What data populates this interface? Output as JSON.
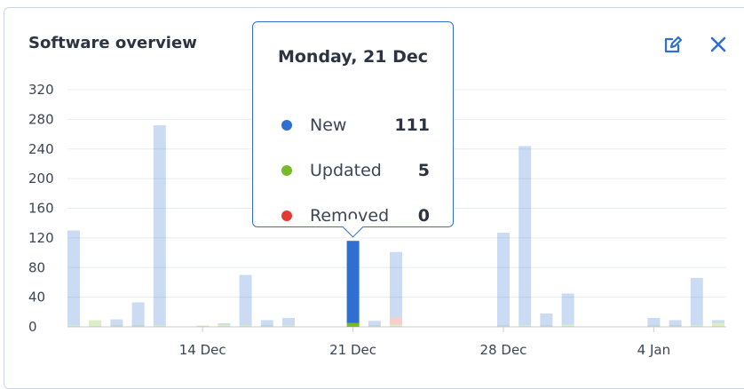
{
  "widget": {
    "title": "Software overview",
    "edit_icon": "edit-icon",
    "close_icon": "close-icon",
    "accent": "#2f6fd1"
  },
  "tooltip": {
    "date": "Monday, 21 Dec",
    "rows": [
      {
        "label": "New",
        "value": "111",
        "color": "#2f6fd1"
      },
      {
        "label": "Updated",
        "value": "5",
        "color": "#7ab929"
      },
      {
        "label": "Removed",
        "value": "0",
        "color": "#e03c31"
      }
    ]
  },
  "chart_data": {
    "type": "bar",
    "stacked": true,
    "categories": [
      "8 Dec",
      "9 Dec",
      "10 Dec",
      "11 Dec",
      "12 Dec",
      "13 Dec",
      "14 Dec",
      "15 Dec",
      "16 Dec",
      "17 Dec",
      "18 Dec",
      "19 Dec",
      "20 Dec",
      "21 Dec",
      "22 Dec",
      "23 Dec",
      "24 Dec",
      "25 Dec",
      "26 Dec",
      "27 Dec",
      "28 Dec",
      "29 Dec",
      "30 Dec",
      "31 Dec",
      "1 Jan",
      "2 Jan",
      "3 Jan",
      "4 Jan",
      "5 Jan",
      "6 Jan",
      "7 Jan"
    ],
    "x_ticks": [
      "14 Dec",
      "21 Dec",
      "28 Dec",
      "4 Jan"
    ],
    "series": [
      {
        "name": "New",
        "color": "#2f6fd1",
        "values": [
          128,
          0,
          9,
          32,
          270,
          0,
          0,
          1,
          68,
          8,
          10,
          0,
          0,
          111,
          7,
          88,
          0,
          0,
          0,
          0,
          126,
          242,
          17,
          42,
          0,
          0,
          0,
          11,
          8,
          64,
          4
        ]
      },
      {
        "name": "Updated",
        "color": "#7ab929",
        "values": [
          2,
          9,
          1,
          1,
          2,
          0,
          1,
          3,
          2,
          1,
          2,
          0,
          0,
          5,
          1,
          3,
          0,
          0,
          0,
          0,
          1,
          2,
          1,
          3,
          0,
          0,
          0,
          1,
          1,
          2,
          5
        ]
      },
      {
        "name": "Removed",
        "color": "#e03c31",
        "values": [
          0,
          0,
          0,
          0,
          0,
          0,
          0,
          0,
          0,
          0,
          0,
          0,
          0,
          0,
          0,
          10,
          0,
          0,
          0,
          0,
          0,
          0,
          0,
          0,
          0,
          0,
          0,
          0,
          0,
          0,
          0
        ]
      }
    ],
    "highlighted": "21 Dec",
    "ylim": [
      0,
      320
    ],
    "y_ticks": [
      0,
      40,
      80,
      120,
      160,
      200,
      240,
      280,
      320
    ],
    "grid": true
  }
}
